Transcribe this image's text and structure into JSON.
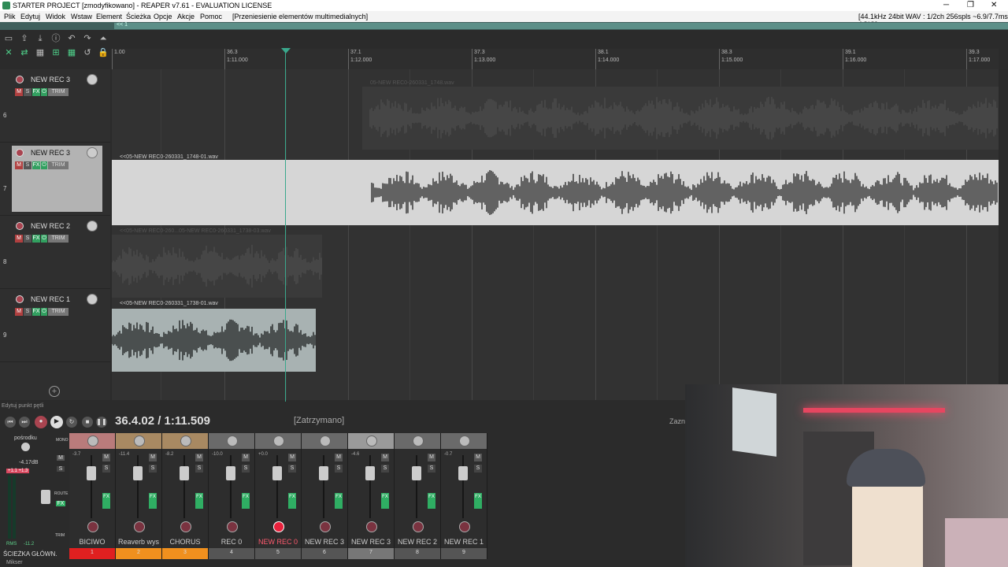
{
  "window": {
    "title": "STARTER PROJECT [zmodyfikowano] - REAPER v7.61 - EVALUATION LICENSE",
    "controls": [
      "─",
      "❐",
      "✕"
    ]
  },
  "menu": {
    "items": [
      "Plik",
      "Edytuj",
      "Widok",
      "Wstaw",
      "Element",
      "Ścieżka",
      "Opcje",
      "Akcje",
      "Pomoc"
    ],
    "action_text": "[Przeniesienie elementów multimedialnych]",
    "audio_status": "[44.1kHz 24bit WAV : 1/2ch 256spls ~6.9/7.7ms ASIO]"
  },
  "region_bar": {
    "label": "<< 1"
  },
  "ruler": {
    "marks": [
      {
        "a": "1.00",
        "b": ""
      },
      {
        "a": "36.3",
        "b": "1:11.000"
      },
      {
        "a": "37.1",
        "b": "1:12.000"
      },
      {
        "a": "37.3",
        "b": "1:13.000"
      },
      {
        "a": "38.1",
        "b": "1:14.000"
      },
      {
        "a": "38.3",
        "b": "1:15.000"
      },
      {
        "a": "39.1",
        "b": "1:16.000"
      },
      {
        "a": "39.3",
        "b": "1:17.000"
      }
    ]
  },
  "tracks": [
    {
      "number": "6",
      "name": "NEW REC 3",
      "selected": false,
      "item": "05-NEW REC0-260331_1748.wav"
    },
    {
      "number": "7",
      "name": "NEW REC 3",
      "selected": true,
      "item": "<<05-NEW REC0-260331_1748-01.wav"
    },
    {
      "number": "8",
      "name": "NEW REC 2",
      "selected": false,
      "item": "<<05-NEW REC0-260...05-NEW REC0-260331_1738-03.wav"
    },
    {
      "number": "9",
      "name": "NEW REC 1",
      "selected": false,
      "item": "<<05-NEW REC0-260331_1738-01.wav"
    }
  ],
  "track_buttons": {
    "m": "M",
    "s": "S",
    "fx": "FX",
    "o": "⏻",
    "trim": "TRIM"
  },
  "transport": {
    "loop_hint": "Edytuj punkt pętli",
    "position": "36.4.02 / 1:11.509",
    "state": "[Zatrzymano]",
    "partial_label": "Zazn"
  },
  "master": {
    "pan_label": "pośrodku",
    "level": "-4.17dB",
    "peak": "+1.1 +1.3",
    "rms": "RMS",
    "rms_value": "-11.2",
    "buttons": [
      "MONO",
      "M",
      "S",
      "ROUTE",
      "FX",
      "TRIM"
    ],
    "name": "ŚCIEŻKA GŁÓWN.",
    "mixer_label": "Mikser"
  },
  "strips": [
    {
      "name": "BICIWO",
      "index": "1",
      "db": "-3.7",
      "color": "#e02020",
      "hdr": "#b97b7b",
      "armed": false
    },
    {
      "name": "Reaverb wys",
      "index": "2",
      "db": "-11.4",
      "color": "#f0901e",
      "hdr": "#a88962",
      "armed": false
    },
    {
      "name": "CHORUS",
      "index": "3",
      "db": "-8.2",
      "color": "#f0901e",
      "hdr": "#a88962",
      "armed": false
    },
    {
      "name": "REC 0",
      "index": "4",
      "db": "-10.0",
      "color": "#555555",
      "hdr": "#6a6a6a",
      "armed": false
    },
    {
      "name": "NEW REC 0",
      "index": "5",
      "db": "+0.0",
      "color": "#555555",
      "hdr": "#6a6a6a",
      "armed": true
    },
    {
      "name": "NEW REC 3",
      "index": "6",
      "db": "",
      "color": "#555555",
      "hdr": "#6a6a6a",
      "armed": false
    },
    {
      "name": "NEW REC 3",
      "index": "7",
      "db": "-4.6",
      "color": "#777777",
      "hdr": "#9a9a9a",
      "armed": false
    },
    {
      "name": "NEW REC 2",
      "index": "8",
      "db": "",
      "color": "#555555",
      "hdr": "#6a6a6a",
      "armed": false
    },
    {
      "name": "NEW REC 1",
      "index": "9",
      "db": "-0.7",
      "color": "#555555",
      "hdr": "#6a6a6a",
      "armed": false
    }
  ],
  "colors": {
    "accent": "#3aa88c",
    "record": "#a94450",
    "fx": "#32a060"
  }
}
